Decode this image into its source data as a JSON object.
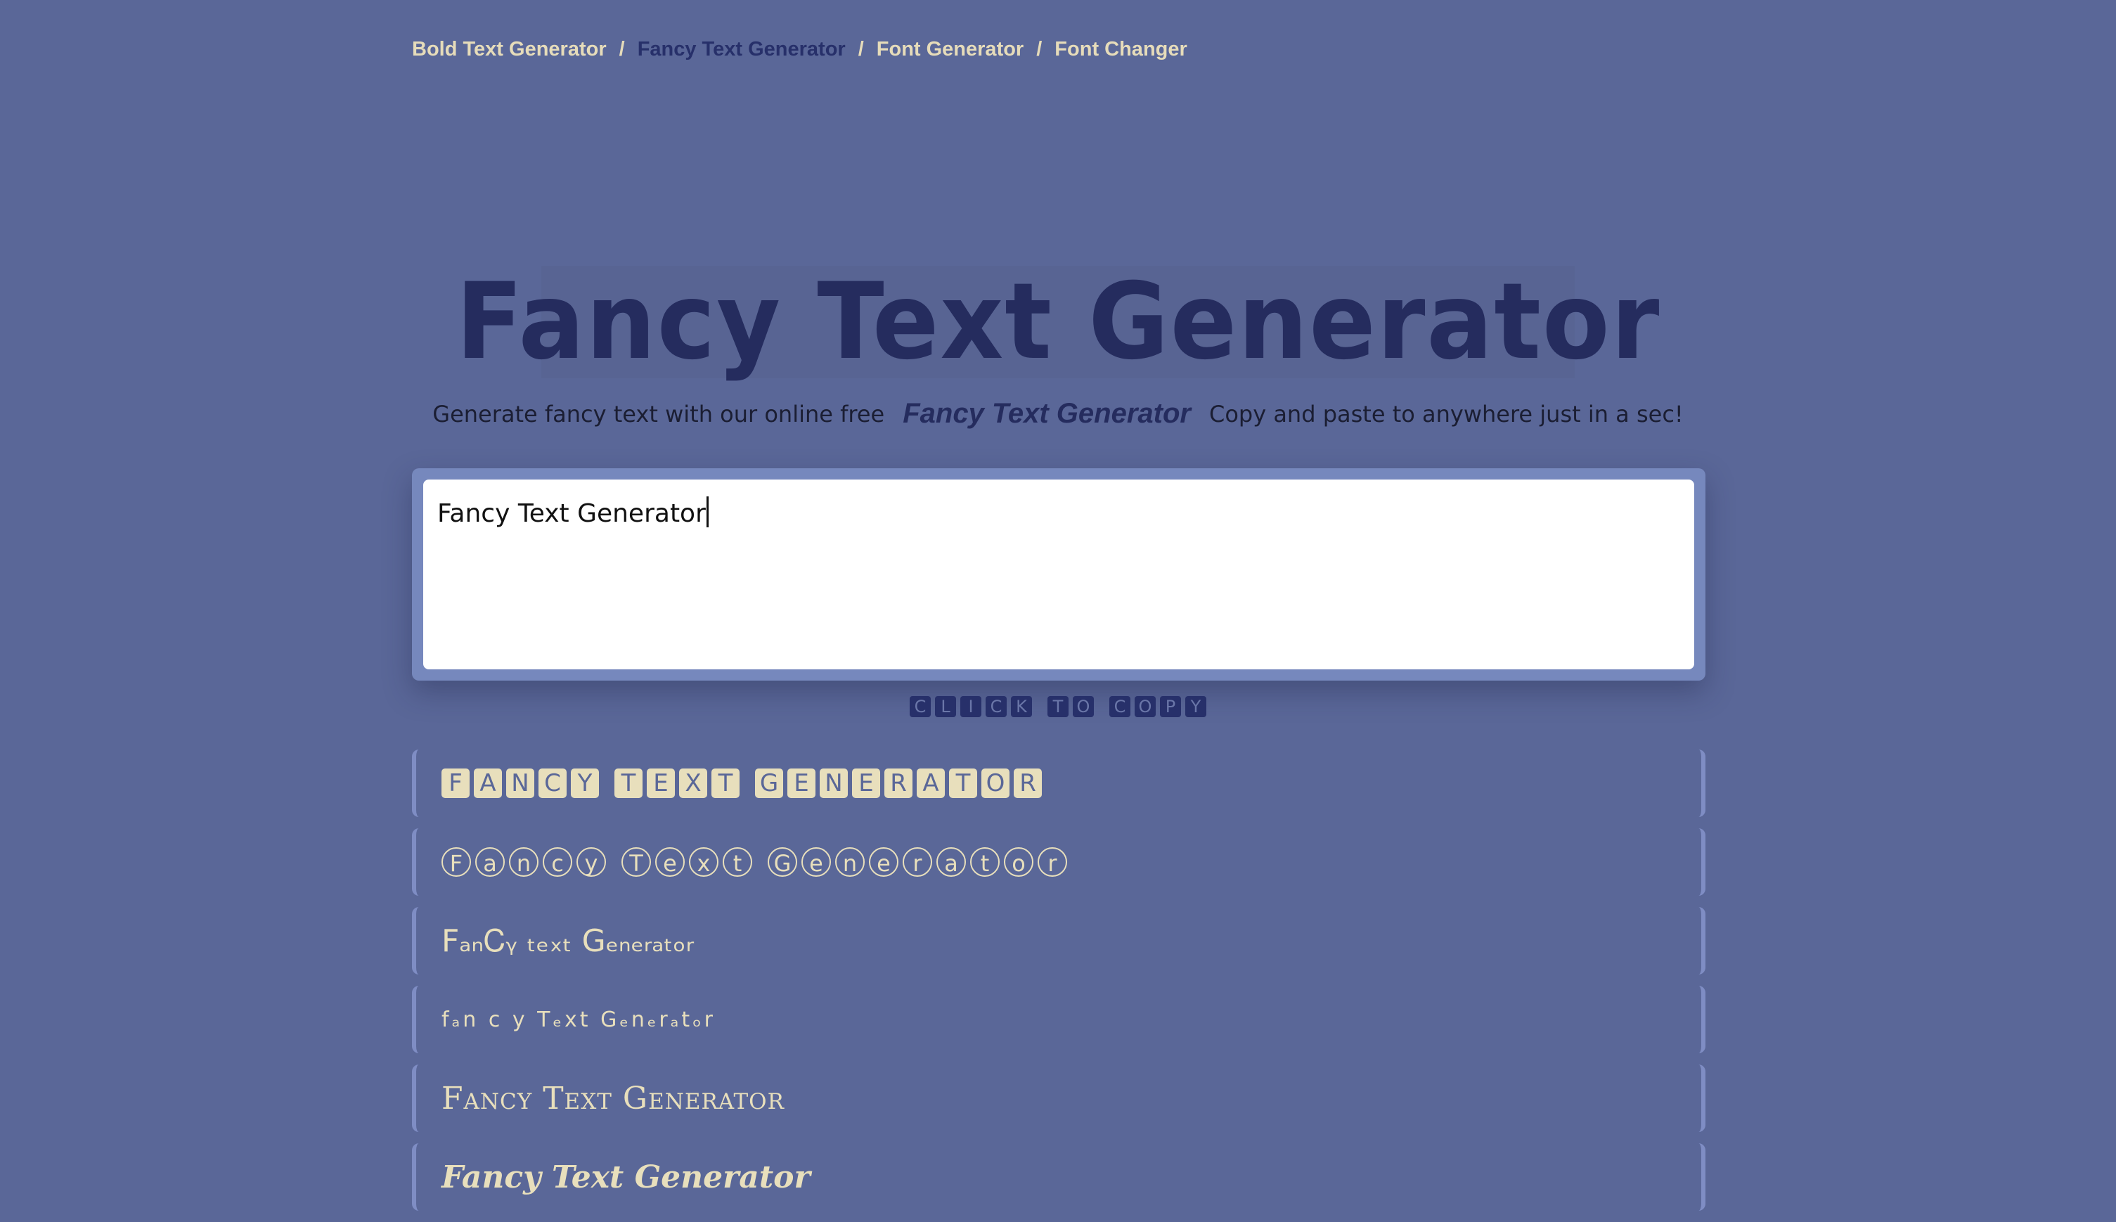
{
  "breadcrumbs": [
    {
      "label": "Bold Text Generator",
      "active": false
    },
    {
      "label": "Fancy Text Generator",
      "active": true
    },
    {
      "label": "Font Generator",
      "active": false
    },
    {
      "label": "Font Changer",
      "active": false
    }
  ],
  "breadcrumb_separator": "/",
  "hero": {
    "title": "Fancy Text Generator"
  },
  "tagline": {
    "before": "Generate fancy text with our online free",
    "emphasis": "Fancy Text Generator",
    "after": "Copy and paste to anywhere just in a sec!"
  },
  "editor": {
    "value": "Fancy Text Generator"
  },
  "copy_hint": "CLICK TO COPY",
  "results": [
    {
      "style": "boxes",
      "text": "FANCY TEXT GENERATOR"
    },
    {
      "style": "circles",
      "text": "Fancy Text Generator"
    },
    {
      "style": "wavy",
      "text": "FₐₙᏟᵧ ₜₑₓₜ Gₑₙₑᵣₐₜₒᵣ"
    },
    {
      "style": "tiny",
      "text": "fₐn c y  Tₑxt  Gₑnₑrₐtₒr"
    },
    {
      "style": "smallcaps",
      "text": "Fancy Text Generator"
    },
    {
      "style": "fraktur",
      "text": "Fancy Text Generator"
    }
  ],
  "colors": {
    "background": "#5a6798",
    "accent_dark": "#252c5e",
    "accent_light": "#e8dfbc"
  }
}
